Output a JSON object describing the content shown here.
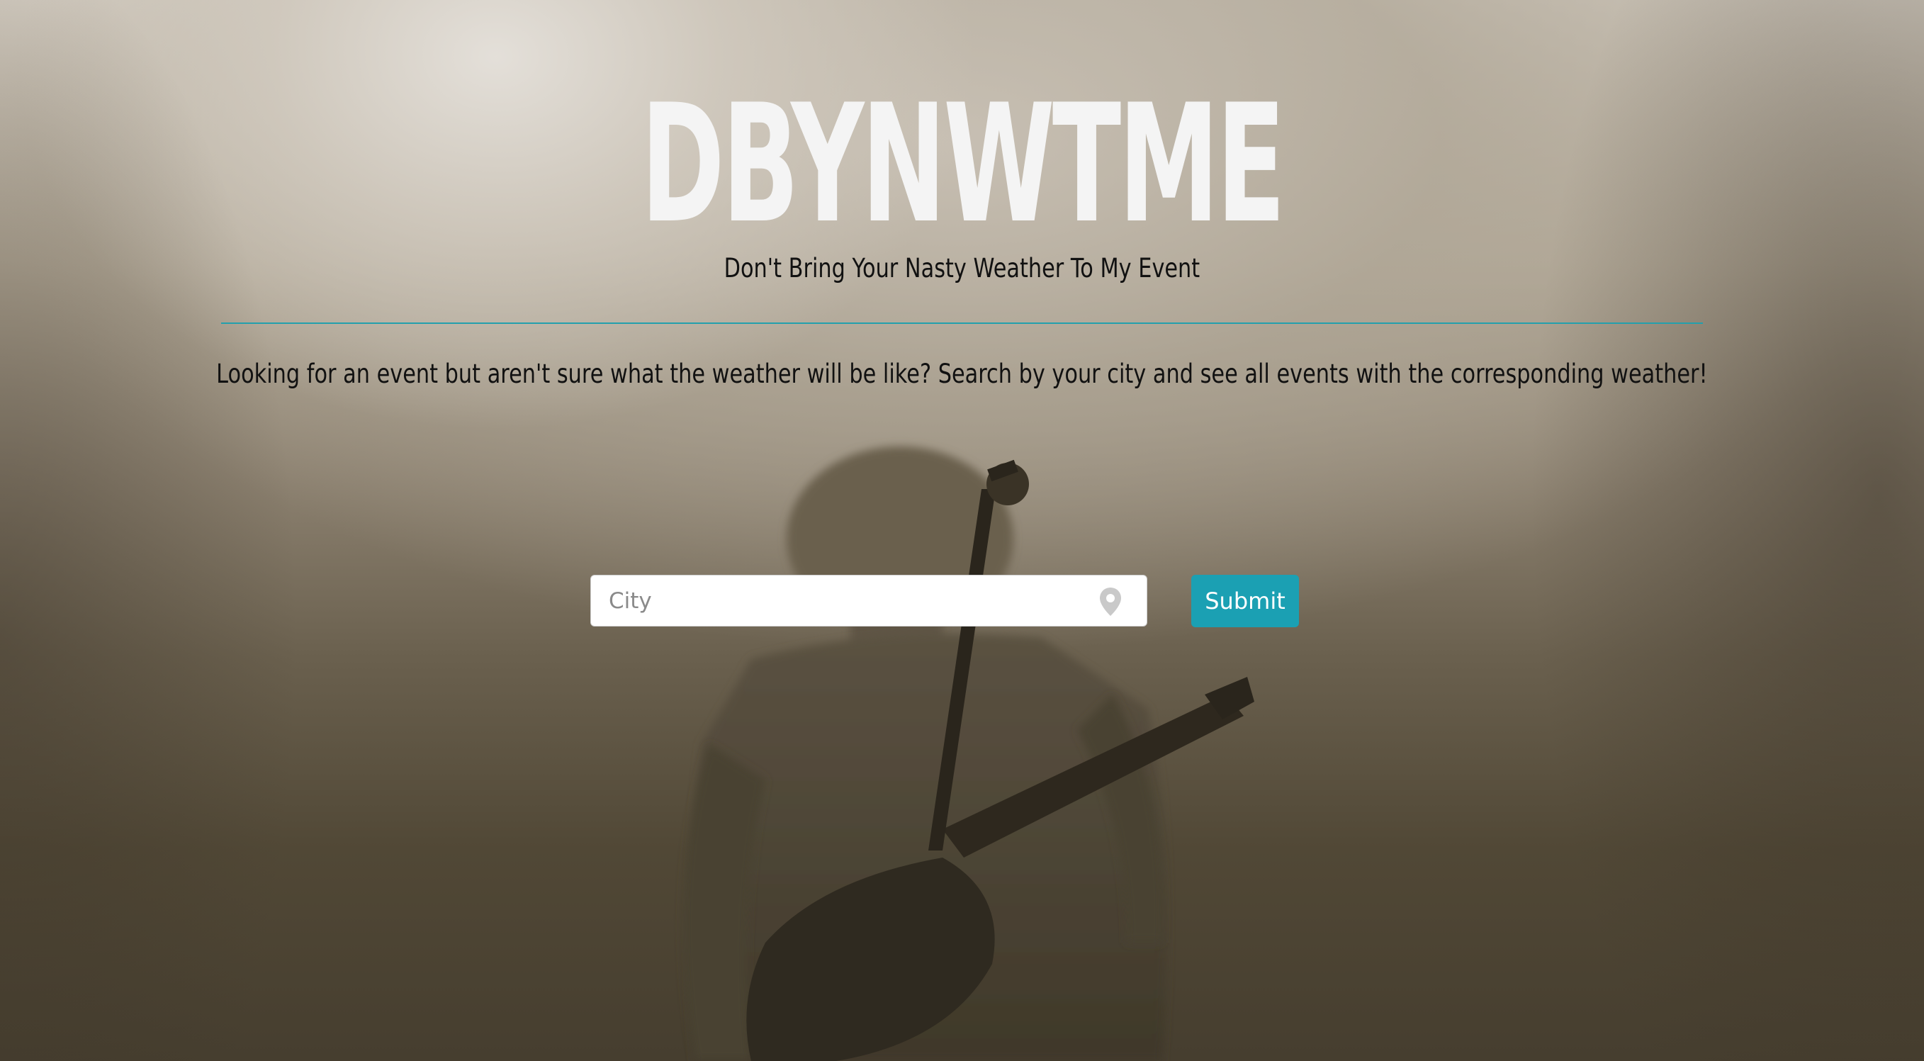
{
  "header": {
    "title": "DBYNWTME",
    "subtitle": "Don't Bring Your Nasty Weather To My Event"
  },
  "intro": {
    "text": "Looking for an event but aren't sure what the weather will be like? Search by your city and see all events with the corresponding weather!"
  },
  "search": {
    "city_placeholder": "City",
    "city_value": "",
    "location_icon": "map-pin-icon",
    "submit_label": "Submit"
  },
  "colors": {
    "accent": "#1ba0b3",
    "divider": "#23a0ad",
    "title": "#f4f4f4",
    "text": "#111111"
  },
  "background": {
    "image": "concert guitarist silhouette with microphone, sepia haze"
  }
}
